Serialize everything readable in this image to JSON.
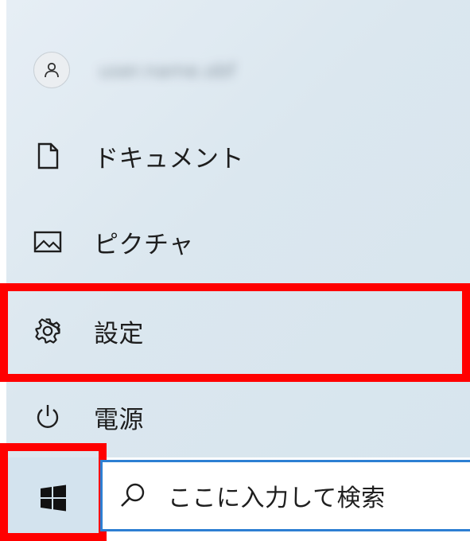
{
  "start_menu": {
    "user": {
      "name": "user.name.obf",
      "avatar_icon": "person-icon"
    },
    "items": [
      {
        "label": "ドキュメント",
        "icon": "document-icon"
      },
      {
        "label": "ピクチャ",
        "icon": "picture-icon"
      },
      {
        "label": "設定",
        "icon": "gear-icon"
      },
      {
        "label": "電源",
        "icon": "power-icon"
      }
    ]
  },
  "taskbar": {
    "start_icon": "windows-logo-icon",
    "search": {
      "placeholder": "ここに入力して検索",
      "icon": "search-icon"
    }
  },
  "colors": {
    "highlight": "#ff0000",
    "search_border": "#2d7fd3",
    "start_bg": "#d3e3ee"
  }
}
